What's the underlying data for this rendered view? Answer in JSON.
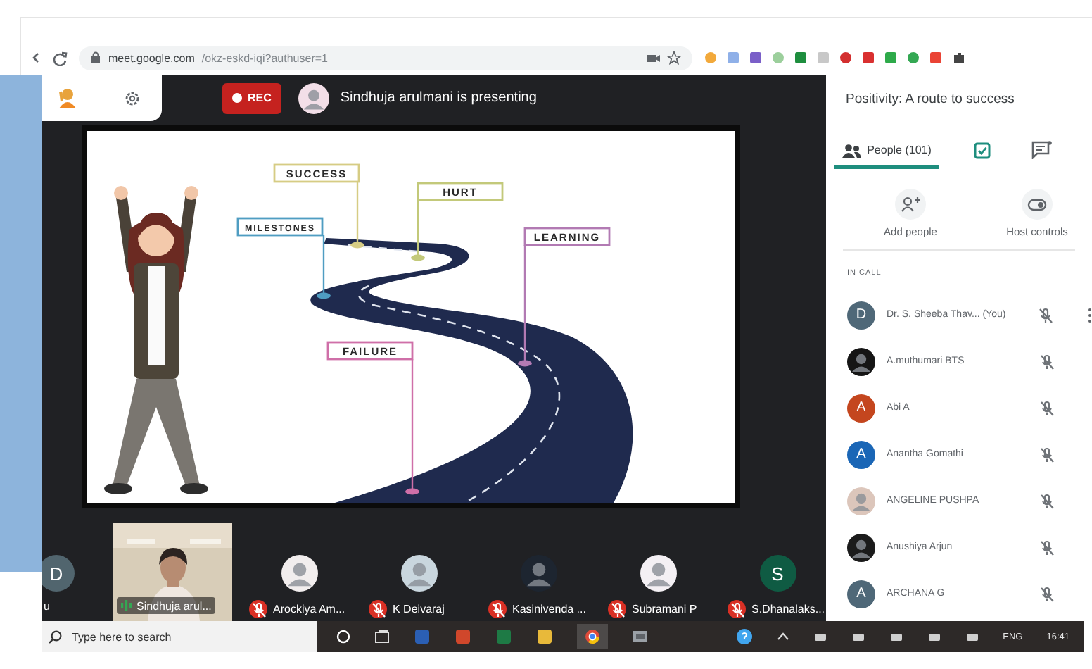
{
  "browser": {
    "url_host": "meet.google.com",
    "url_path": "/okz-eskd-iqi?authuser=1"
  },
  "meeting": {
    "recording_label": "REC",
    "presenting_text": "Sindhuja arulmani is presenting"
  },
  "slide": {
    "signs": [
      {
        "label": "SUCCESS",
        "color": "#d6cc84"
      },
      {
        "label": "HURT",
        "color": "#c3c97a"
      },
      {
        "label": "MILESTONES",
        "color": "#4f9dc2"
      },
      {
        "label": "LEARNING",
        "color": "#b27ab3"
      },
      {
        "label": "FAILURE",
        "color": "#cf6fa8"
      }
    ]
  },
  "filmstrip": [
    {
      "kind": "letter",
      "letter": "D",
      "name": "u",
      "color": "#51656e",
      "muted": false
    },
    {
      "kind": "video",
      "name": "Sindhuja arul...",
      "muted": false
    },
    {
      "name": "Arockiya Am...",
      "color": "#f2eeee",
      "muted": true
    },
    {
      "name": "K Deivaraj",
      "color": "#c9d6de",
      "muted": true
    },
    {
      "name": "Kasinivenda ...",
      "color": "#1d2530",
      "muted": true
    },
    {
      "name": "Subramani P",
      "color": "#f4f0f4",
      "muted": true
    },
    {
      "kind": "letter",
      "letter": "S",
      "name": "S.Dhanalaks...",
      "color": "#0f5b43",
      "muted": true
    }
  ],
  "panel": {
    "title": "Positivity: A route to success",
    "tabs": [
      {
        "kind": "people",
        "label": "People (101)",
        "selected": true
      },
      {
        "kind": "activities",
        "selected": false
      },
      {
        "kind": "chat",
        "selected": false
      }
    ],
    "actions": [
      {
        "kind": "add",
        "label": "Add people"
      },
      {
        "kind": "host",
        "label": "Host controls"
      }
    ],
    "section": "IN CALL",
    "participants": [
      {
        "name": "Dr. S. Sheeba Thav... (You)",
        "kind": "letter",
        "letter": "D",
        "color": "#4f6878",
        "muted": true,
        "more_menu": true
      },
      {
        "name": "A.muthumari BTS",
        "color": "#151515",
        "muted": true,
        "more_menu": false
      },
      {
        "name": "Abi A",
        "kind": "letter",
        "letter": "A",
        "color": "#c4461e",
        "muted": true,
        "more_menu": false
      },
      {
        "name": "Anantha Gomathi",
        "kind": "letter",
        "letter": "A",
        "color": "#1a66b6",
        "muted": true,
        "more_menu": false
      },
      {
        "name": "ANGELINE PUSHPA",
        "color": "#dcc6bb",
        "muted": true,
        "more_menu": false
      },
      {
        "name": "Anushiya Arjun",
        "color": "#1b1b1b",
        "muted": true,
        "more_menu": false
      },
      {
        "name": "ARCHANA G",
        "kind": "letter",
        "letter": "A",
        "color": "#4f6878",
        "muted": true,
        "more_menu": false
      }
    ]
  },
  "taskbar": {
    "search_placeholder": "Type here to search",
    "language": "ENG",
    "time": "16:41"
  }
}
